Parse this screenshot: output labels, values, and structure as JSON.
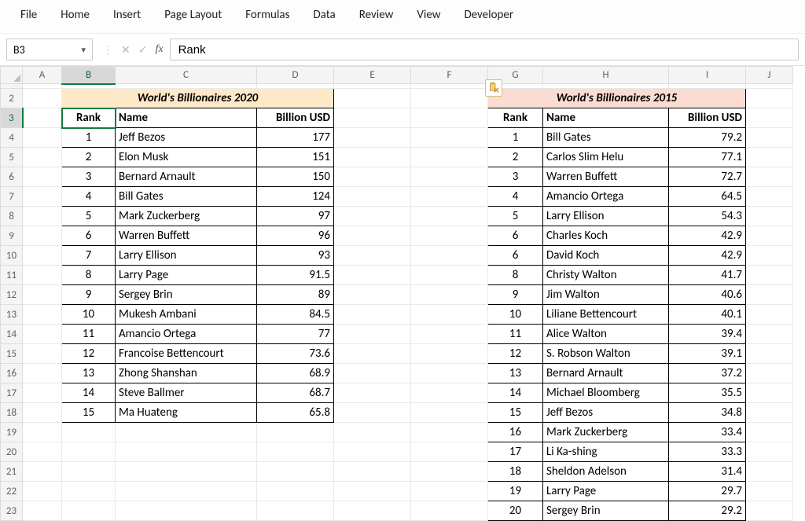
{
  "menu": {
    "file": "File",
    "home": "Home",
    "insert": "Insert",
    "page_layout": "Page Layout",
    "formulas": "Formulas",
    "data": "Data",
    "review": "Review",
    "view": "View",
    "developer": "Developer"
  },
  "namebox": {
    "value": "B3"
  },
  "fx": {
    "label": "fx"
  },
  "formula": {
    "value": "Rank"
  },
  "columns": [
    "A",
    "B",
    "C",
    "D",
    "E",
    "F",
    "G",
    "H",
    "I",
    "J"
  ],
  "rows_visible_start": 2,
  "rows_visible_end": 23,
  "active_cell": "B3",
  "titles": {
    "t2020": "World's Billionaires 2020",
    "t2015": "World's Billionaires 2015"
  },
  "headers": {
    "rank": "Rank",
    "name": "Name",
    "usd": "Billion USD"
  },
  "table2020": [
    {
      "rank": 1,
      "name": "Jeff Bezos",
      "usd": "177"
    },
    {
      "rank": 2,
      "name": "Elon Musk",
      "usd": "151"
    },
    {
      "rank": 3,
      "name": "Bernard Arnault",
      "usd": "150"
    },
    {
      "rank": 4,
      "name": "Bill Gates",
      "usd": "124"
    },
    {
      "rank": 5,
      "name": "Mark Zuckerberg",
      "usd": "97"
    },
    {
      "rank": 6,
      "name": "Warren Buffett",
      "usd": "96"
    },
    {
      "rank": 7,
      "name": "Larry Ellison",
      "usd": "93"
    },
    {
      "rank": 8,
      "name": "Larry Page",
      "usd": "91.5"
    },
    {
      "rank": 9,
      "name": "Sergey Brin",
      "usd": "89"
    },
    {
      "rank": 10,
      "name": "Mukesh Ambani",
      "usd": "84.5"
    },
    {
      "rank": 11,
      "name": "Amancio Ortega",
      "usd": "77"
    },
    {
      "rank": 12,
      "name": "Francoise Bettencourt",
      "usd": "73.6"
    },
    {
      "rank": 13,
      "name": "Zhong Shanshan",
      "usd": "68.9"
    },
    {
      "rank": 14,
      "name": "Steve Ballmer",
      "usd": "68.7"
    },
    {
      "rank": 15,
      "name": "Ma Huateng",
      "usd": "65.8"
    }
  ],
  "table2015": [
    {
      "rank": 1,
      "name": "Bill Gates",
      "usd": "79.2"
    },
    {
      "rank": 2,
      "name": "Carlos Slim Helu",
      "usd": "77.1"
    },
    {
      "rank": 3,
      "name": "Warren Buffett",
      "usd": "72.7"
    },
    {
      "rank": 4,
      "name": "Amancio Ortega",
      "usd": "64.5"
    },
    {
      "rank": 5,
      "name": "Larry Ellison",
      "usd": "54.3"
    },
    {
      "rank": 6,
      "name": "Charles Koch",
      "usd": "42.9"
    },
    {
      "rank": 6,
      "name": "David Koch",
      "usd": "42.9"
    },
    {
      "rank": 8,
      "name": "Christy Walton",
      "usd": "41.7"
    },
    {
      "rank": 9,
      "name": "Jim Walton",
      "usd": "40.6"
    },
    {
      "rank": 10,
      "name": "Liliane Bettencourt",
      "usd": "40.1"
    },
    {
      "rank": 11,
      "name": "Alice Walton",
      "usd": "39.4"
    },
    {
      "rank": 12,
      "name": "S. Robson Walton",
      "usd": "39.1"
    },
    {
      "rank": 13,
      "name": "Bernard Arnault",
      "usd": "37.2"
    },
    {
      "rank": 14,
      "name": "Michael Bloomberg",
      "usd": "35.5"
    },
    {
      "rank": 15,
      "name": "Jeff Bezos",
      "usd": "34.8"
    },
    {
      "rank": 16,
      "name": "Mark Zuckerberg",
      "usd": "33.4"
    },
    {
      "rank": 17,
      "name": "Li Ka-shing",
      "usd": "33.3"
    },
    {
      "rank": 18,
      "name": "Sheldon Adelson",
      "usd": "31.4"
    },
    {
      "rank": 19,
      "name": "Larry Page",
      "usd": "29.7"
    },
    {
      "rank": 20,
      "name": "Sergey Brin",
      "usd": "29.2"
    }
  ]
}
